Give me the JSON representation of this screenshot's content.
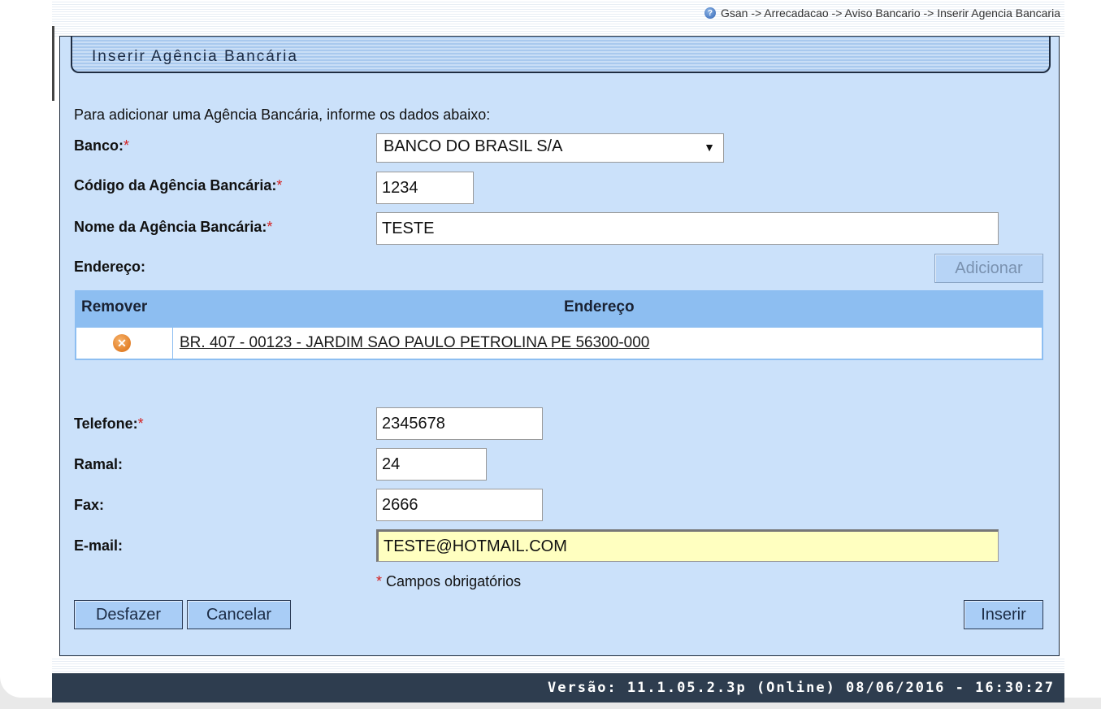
{
  "breadcrumb": "Gsan -> Arrecadacao -> Aviso Bancario -> Inserir Agencia Bancaria",
  "title": "Inserir Agência Bancária",
  "instructions": "Para adicionar uma Agência Bancária, informe os dados abaixo:",
  "required_mark": "*",
  "fields": {
    "banco": {
      "label": "Banco:",
      "value": "BANCO DO BRASIL S/A"
    },
    "codigo": {
      "label": "Código da Agência Bancária:",
      "value": "1234"
    },
    "nome": {
      "label": "Nome da Agência Bancária:",
      "value": "TESTE"
    },
    "endereco": {
      "label": "Endereço:"
    },
    "telefone": {
      "label": "Telefone:",
      "value": "2345678"
    },
    "ramal": {
      "label": "Ramal:",
      "value": "24"
    },
    "fax": {
      "label": "Fax:",
      "value": "2666"
    },
    "email": {
      "label": "E-mail:",
      "value": "TESTE@HOTMAIL.COM",
      "highlight_color": "#ffffc0"
    }
  },
  "address_table": {
    "columns": [
      "Remover",
      "Endereço"
    ],
    "rows": [
      {
        "address": "BR. 407 - 00123 - JARDIM SAO PAULO PETROLINA PE 56300-000"
      }
    ]
  },
  "buttons": {
    "adicionar": "Adicionar",
    "desfazer": "Desfazer",
    "cancelar": "Cancelar",
    "inserir": "Inserir"
  },
  "required_note": "Campos obrigatórios",
  "footer": "Versão: 11.1.05.2.3p (Online) 08/06/2016 - 16:30:27",
  "colors": {
    "panel": "#cbe1fa",
    "table_header": "#8dbef1",
    "footer": "#2e3d4f",
    "required": "#d42020"
  }
}
